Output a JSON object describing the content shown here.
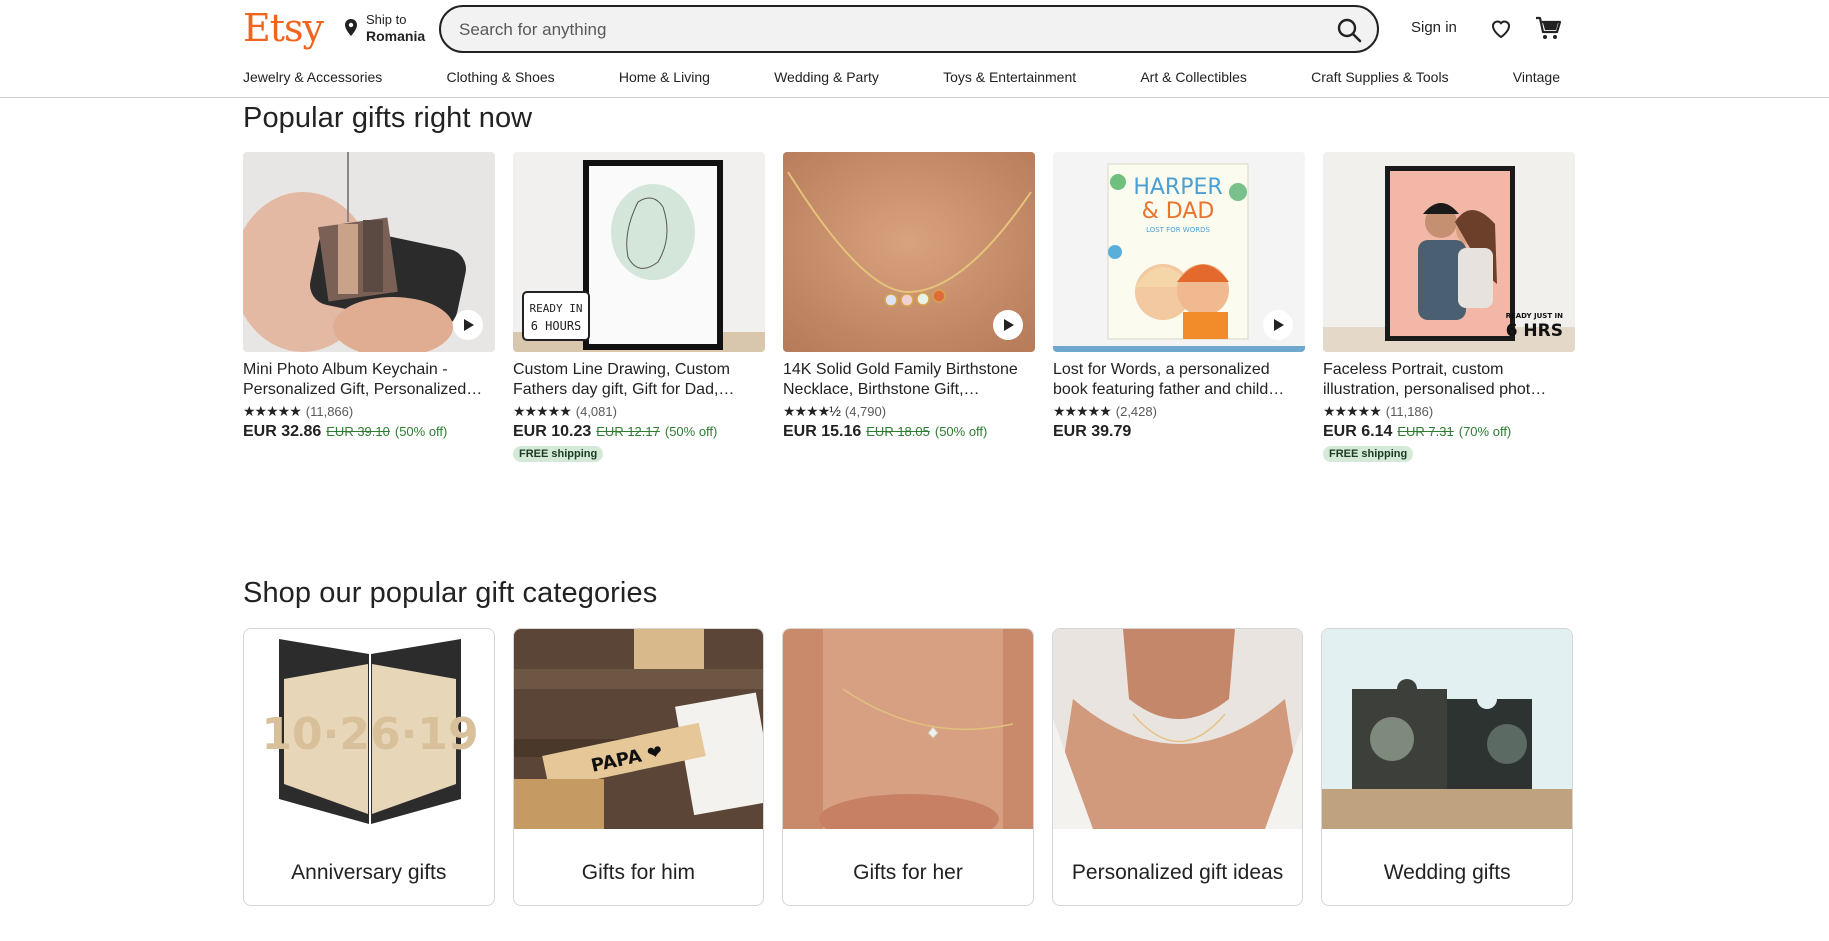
{
  "header": {
    "logo": "Etsy",
    "ship_to_label": "Ship to",
    "ship_to_country": "Romania",
    "search_placeholder": "Search for anything",
    "sign_in": "Sign in",
    "accent_color": "#f1641e"
  },
  "nav": [
    "Jewelry & Accessories",
    "Clothing & Shoes",
    "Home & Living",
    "Wedding & Party",
    "Toys & Entertainment",
    "Art & Collectibles",
    "Craft Supplies & Tools",
    "Vintage"
  ],
  "popular": {
    "title": "Popular gifts right now",
    "items": [
      {
        "title_line1": "Mini Photo Album Keychain -",
        "title_line2": "Personalized Gift, Personalized…",
        "stars": "★★★★★",
        "reviews": "(11,866)",
        "price": "EUR 32.86",
        "old_price": "EUR 39.10",
        "discount": "(50% off)",
        "free_shipping": "",
        "video": true
      },
      {
        "title_line1": "Custom Line Drawing, Custom",
        "title_line2": "Fathers day gift, Gift for Dad,…",
        "stars": "★★★★★",
        "reviews": "(4,081)",
        "price": "EUR 10.23",
        "old_price": "EUR 12.17",
        "discount": "(50% off)",
        "free_shipping": "FREE shipping",
        "badge_line1": "READY IN",
        "badge_line2": "6 HOURS",
        "video": false
      },
      {
        "title_line1": "14K Solid Gold Family Birthstone",
        "title_line2": "Necklace, Birthstone Gift,…",
        "stars": "★★★★½",
        "reviews": "(4,790)",
        "price": "EUR 15.16",
        "old_price": "EUR 18.05",
        "discount": "(50% off)",
        "free_shipping": "",
        "video": true
      },
      {
        "title_line1": "Lost for Words, a personalized",
        "title_line2": "book featuring father and child…",
        "stars": "★★★★★",
        "reviews": "(2,428)",
        "price": "EUR 39.79",
        "old_price": "",
        "discount": "",
        "free_shipping": "",
        "book_title1": "HARPER",
        "book_title2": "& DAD",
        "book_sub": "LOST FOR WORDS",
        "video": true
      },
      {
        "title_line1": "Faceless Portrait, custom",
        "title_line2": "illustration, personalised phot…",
        "stars": "★★★★★",
        "reviews": "(11,186)",
        "price": "EUR 6.14",
        "old_price": "EUR 7.31",
        "discount": "(70% off)",
        "free_shipping": "FREE shipping",
        "badge_line1": "READY JUST IN",
        "badge_line2": "6 HRS",
        "video": false
      }
    ]
  },
  "categories": {
    "title": "Shop our popular gift categories",
    "items": [
      {
        "label": "Anniversary gifts",
        "art_text": "10·26·19"
      },
      {
        "label": "Gifts for him",
        "art_text": "PAPA ❤"
      },
      {
        "label": "Gifts for her"
      },
      {
        "label": "Personalized gift ideas"
      },
      {
        "label": "Wedding gifts"
      }
    ]
  }
}
